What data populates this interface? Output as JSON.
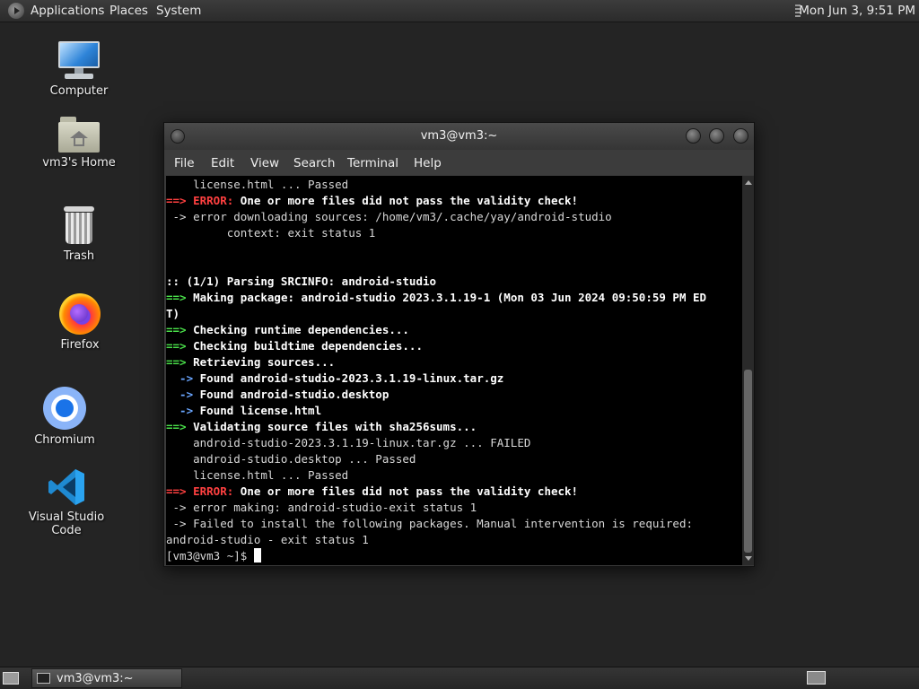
{
  "top_panel": {
    "menus": [
      "Applications",
      "Places",
      "System"
    ],
    "clock": "Mon Jun  3,  9:51 PM"
  },
  "desktop": {
    "icons": [
      {
        "label": "Computer",
        "icon": "computer-icon"
      },
      {
        "label": "vm3's Home",
        "icon": "home-folder-icon"
      },
      {
        "label": "Trash",
        "icon": "trash-icon"
      },
      {
        "label": "Firefox",
        "icon": "firefox-icon"
      },
      {
        "label": "Chromium",
        "icon": "chromium-icon"
      },
      {
        "label": "Visual Studio Code",
        "icon": "vscode-icon"
      }
    ]
  },
  "terminal": {
    "title": "vm3@vm3:~",
    "menu": [
      "File",
      "Edit",
      "View",
      "Search",
      "Terminal",
      "Help"
    ],
    "lines": [
      [
        {
          "t": "    license.html ... Passed",
          "s": ""
        }
      ],
      [
        {
          "t": "==> ",
          "s": "r"
        },
        {
          "t": "ERROR:",
          "s": "r"
        },
        {
          "t": " One or more files did not pass the validity check!",
          "s": "b"
        }
      ],
      [
        {
          "t": " -> error downloading sources: /home/vm3/.cache/yay/android-studio",
          "s": ""
        }
      ],
      [
        {
          "t": "         context: exit status 1",
          "s": ""
        }
      ],
      [],
      [],
      [
        {
          "t": ":: (1/1) Parsing SRCINFO: android-studio",
          "s": "b"
        }
      ],
      [
        {
          "t": "==> ",
          "s": "g"
        },
        {
          "t": "Making package: android-studio 2023.3.1.19-1 (Mon 03 Jun 2024 09:50:59 PM ED",
          "s": "b"
        }
      ],
      [
        {
          "t": "T)",
          "s": "b"
        }
      ],
      [
        {
          "t": "==> ",
          "s": "g"
        },
        {
          "t": "Checking runtime dependencies...",
          "s": "b"
        }
      ],
      [
        {
          "t": "==> ",
          "s": "g"
        },
        {
          "t": "Checking buildtime dependencies...",
          "s": "b"
        }
      ],
      [
        {
          "t": "==> ",
          "s": "g"
        },
        {
          "t": "Retrieving sources...",
          "s": "b"
        }
      ],
      [
        {
          "t": "  -> ",
          "s": "bl"
        },
        {
          "t": "Found android-studio-2023.3.1.19-linux.tar.gz",
          "s": "b"
        }
      ],
      [
        {
          "t": "  -> ",
          "s": "bl"
        },
        {
          "t": "Found android-studio.desktop",
          "s": "b"
        }
      ],
      [
        {
          "t": "  -> ",
          "s": "bl"
        },
        {
          "t": "Found license.html",
          "s": "b"
        }
      ],
      [
        {
          "t": "==> ",
          "s": "g"
        },
        {
          "t": "Validating source files with sha256sums...",
          "s": "b"
        }
      ],
      [
        {
          "t": "    android-studio-2023.3.1.19-linux.tar.gz ... FAILED",
          "s": ""
        }
      ],
      [
        {
          "t": "    android-studio.desktop ... Passed",
          "s": ""
        }
      ],
      [
        {
          "t": "    license.html ... Passed",
          "s": ""
        }
      ],
      [
        {
          "t": "==> ",
          "s": "r"
        },
        {
          "t": "ERROR:",
          "s": "r"
        },
        {
          "t": " One or more files did not pass the validity check!",
          "s": "b"
        }
      ],
      [
        {
          "t": " -> error making: android-studio-exit status 1",
          "s": ""
        }
      ],
      [
        {
          "t": " -> Failed to install the following packages. Manual intervention is required:",
          "s": ""
        }
      ],
      [
        {
          "t": "android-studio - exit status 1",
          "s": ""
        }
      ]
    ],
    "prompt": "[vm3@vm3 ~]$ "
  },
  "bottom_panel": {
    "task_label": "vm3@vm3:~"
  }
}
